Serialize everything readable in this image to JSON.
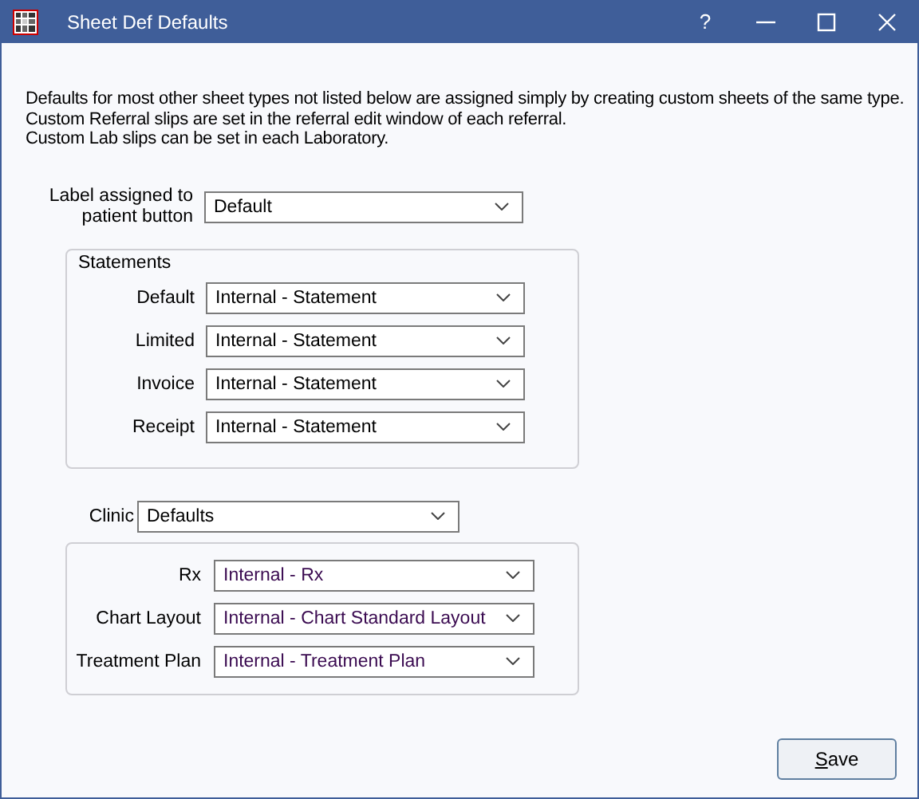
{
  "window": {
    "title": "Sheet Def Defaults",
    "controls": [
      "?"
    ]
  },
  "intro": [
    "Defaults for most other sheet types not listed below are assigned simply by creating custom sheets of the same type.",
    "Custom Referral slips are set in the referral edit window of each referral.",
    "Custom Lab slips can be set in each Laboratory."
  ],
  "patient_label": {
    "label": "Label assigned to patient button",
    "value": "Default"
  },
  "statements": {
    "title": "Statements",
    "rows": [
      {
        "label": "Default",
        "value": "Internal - Statement"
      },
      {
        "label": "Limited",
        "value": "Internal - Statement"
      },
      {
        "label": "Invoice",
        "value": "Internal - Statement"
      },
      {
        "label": "Receipt",
        "value": "Internal - Statement"
      }
    ]
  },
  "clinic": {
    "label": "Clinic",
    "value": "Defaults"
  },
  "clinic_sheets": [
    {
      "label": "Rx",
      "value": "Internal - Rx"
    },
    {
      "label": "Chart Layout",
      "value": "Internal - Chart Standard Layout"
    },
    {
      "label": "Treatment Plan",
      "value": "Internal - Treatment Plan"
    }
  ],
  "buttons": [
    "Save"
  ]
}
